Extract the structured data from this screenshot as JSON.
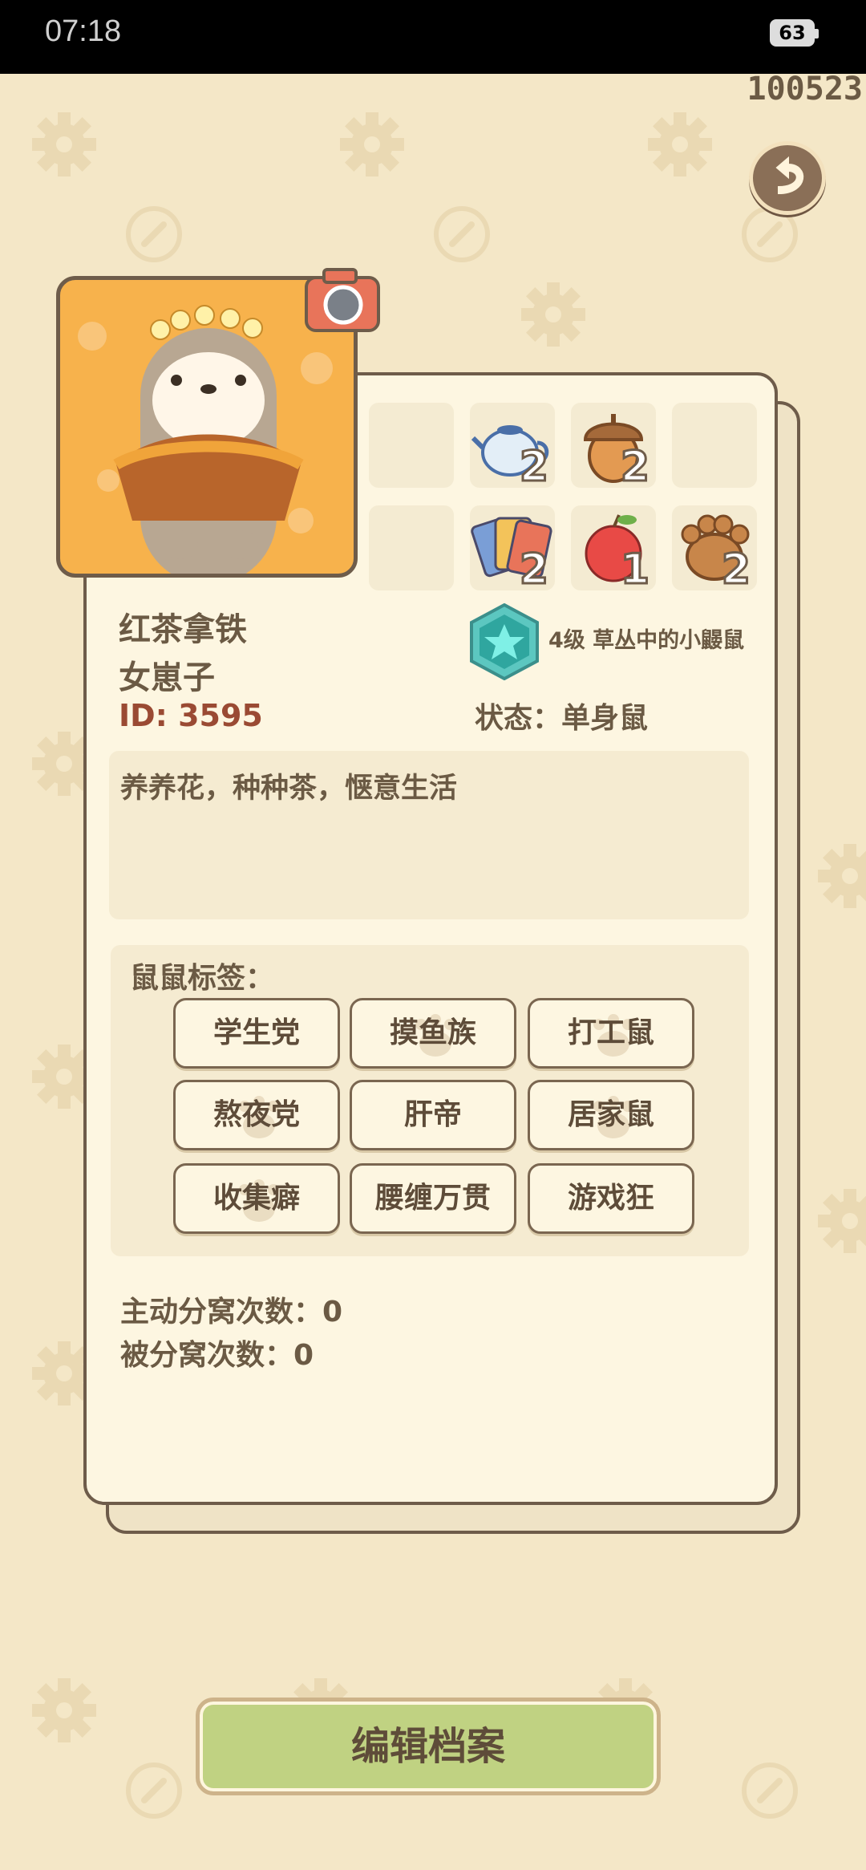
{
  "status_bar": {
    "time": "07:18",
    "battery": "63"
  },
  "header": {
    "coins": "100523",
    "back_icon": "back-arrow-icon"
  },
  "profile": {
    "name": "红茶拿铁",
    "gender": "女崽子",
    "id_text": "ID: 3595",
    "level_text": "4级 草丛中的小鼹鼠",
    "status_text": "状态：单身鼠",
    "bio": "养养花，种种茶，惬意生活"
  },
  "inventory": {
    "items": [
      {
        "icon": "teapot-icon",
        "count": "2"
      },
      {
        "icon": "acorn-icon",
        "count": "2"
      },
      {
        "icon": "cards-icon",
        "count": "2"
      },
      {
        "icon": "apple-icon",
        "count": "1"
      },
      {
        "icon": "paw-icon",
        "count": "2"
      }
    ]
  },
  "tags": {
    "title": "鼠鼠标签：",
    "items": [
      "学生党",
      "摸鱼族",
      "打工鼠",
      "熬夜党",
      "肝帝",
      "居家鼠",
      "收集癖",
      "腰缠万贯",
      "游戏狂"
    ]
  },
  "stats": {
    "active_split": "主动分窝次数：0",
    "passive_split": "被分窝次数：0"
  },
  "actions": {
    "edit_label": "编辑档案"
  },
  "colors": {
    "background": "#f4e7c7",
    "card": "#fdf6e1",
    "button": "#c0d282",
    "id_text": "#9a4a33"
  }
}
